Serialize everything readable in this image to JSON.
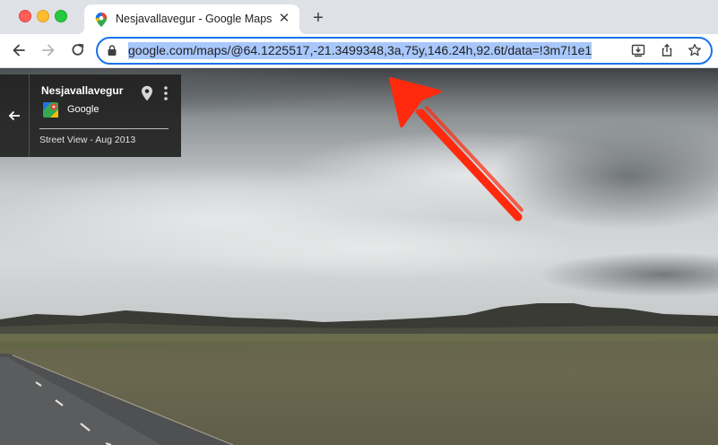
{
  "browser": {
    "tab": {
      "title": "Nesjavallavegur - Google Maps",
      "favicon_icon": "google-maps-pin-icon",
      "close_glyph": "✕"
    },
    "new_tab_glyph": "+",
    "nav": {
      "back_icon": "arrow-left-icon",
      "forward_icon": "arrow-right-icon",
      "reload_icon": "reload-icon"
    },
    "omnibox": {
      "url": "google.com/maps/@64.1225517,-21.3499348,3a,75y,146.24h,92.6t/data=!3m7!1e1",
      "lock_icon": "lock-icon",
      "actions": [
        "install-app-icon",
        "share-icon",
        "bookmark-star-icon"
      ]
    }
  },
  "street_view": {
    "place_name": "Nesjavallavegur",
    "provider": "Google",
    "capture_date": "Street View - Aug 2013",
    "back_icon": "arrow-left-icon",
    "pin_icon": "map-pin-icon",
    "menu_icon": "more-vertical-icon"
  },
  "annotation": {
    "type": "hand-drawn red arrow pointing at address bar",
    "color": "#ff2a0e"
  },
  "colors": {
    "tabstrip": "#dee1e6",
    "omnibox_focus": "#1a73e8",
    "url_selection": "#a8c7fa"
  }
}
